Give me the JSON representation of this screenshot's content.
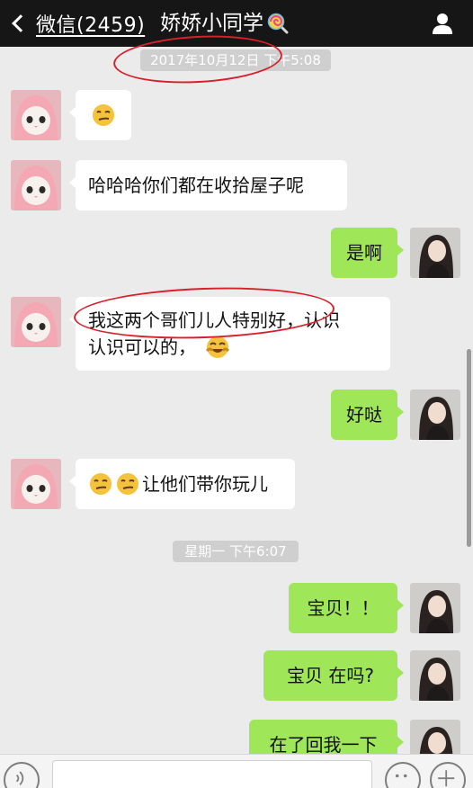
{
  "header": {
    "back_label": "微信(2459)",
    "title": "娇娇小同学",
    "title_emoji": "lollipop-icon",
    "right_icon": "person-icon"
  },
  "timestamps": [
    "2017年10月12日 下午5:08",
    "星期一 下午6:07"
  ],
  "messages": [
    {
      "side": "in",
      "text": "",
      "emojis": [
        "smirk-emoji"
      ]
    },
    {
      "side": "in",
      "text": "哈哈哈你们都在收拾屋子呢"
    },
    {
      "side": "out",
      "text": "是啊"
    },
    {
      "side": "in",
      "text_line1": "我这两个哥们儿人特别好，认识",
      "text_line2": "认识可以的，",
      "emojis": [
        "laugh-emoji"
      ]
    },
    {
      "side": "out",
      "text": "好哒"
    },
    {
      "side": "in",
      "text": "让他们带你玩儿",
      "emojis": [
        "smirk-emoji",
        "smirk-emoji"
      ]
    },
    {
      "side": "out",
      "text": "宝贝！！"
    },
    {
      "side": "out",
      "text": "宝贝 在吗?"
    },
    {
      "side": "out",
      "text": "在了回我一下"
    }
  ],
  "colors": {
    "header_bg": "#161616",
    "chat_bg": "#ebebeb",
    "outgoing_bubble": "#9fe658",
    "incoming_bubble": "#ffffff",
    "annotation": "#d8202c"
  }
}
